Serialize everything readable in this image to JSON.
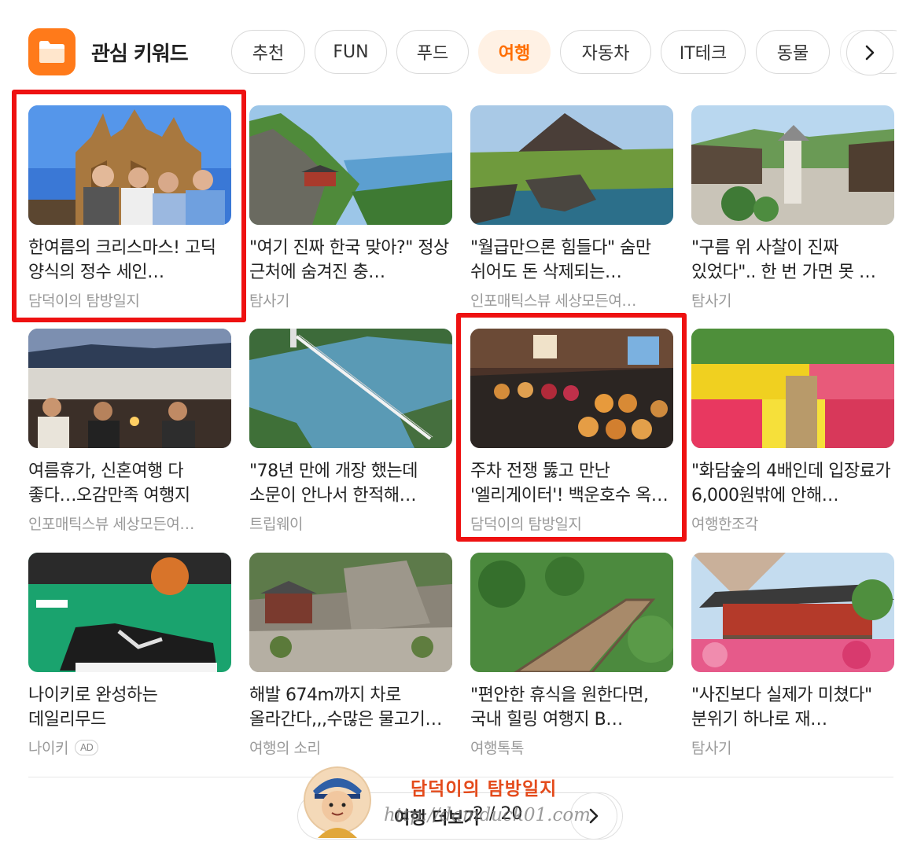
{
  "header": {
    "icon": "folder-icon",
    "title": "관심 키워드",
    "tabs": [
      "추천",
      "FUN",
      "푸드",
      "여행",
      "자동차",
      "IT테크",
      "동물",
      "···"
    ],
    "active_tab": "여행",
    "accent_color": "#ff7a1a"
  },
  "cards": [
    {
      "title": "한여름의 크리스마스! 고딕 양식의 정수 세인…",
      "source": "담덕이의 탐방일지"
    },
    {
      "title": "\"여기 진짜 한국 맞아?\" 정상 근처에 숨겨진 충…",
      "source": "탐사기"
    },
    {
      "title": "\"월급만으론 힘들다\" 숨만 쉬어도 돈 삭제되는…",
      "source": "인포매틱스뷰 세상모든여…"
    },
    {
      "title": "\"구름 위 사찰이 진짜 있었다\".. 한 번 가면 못 …",
      "source": "탐사기"
    },
    {
      "title": "여름휴가, 신혼여행 다 좋다…오감만족 여행지",
      "source": "인포매틱스뷰 세상모든여…"
    },
    {
      "title": "\"78년 만에 개장 했는데 소문이 안나서 한적해…",
      "source": "트립웨이"
    },
    {
      "title": "주차 전쟁 뚫고 만난 '엘리게이터'! 백운호수 옥…",
      "source": "담덕이의 탐방일지"
    },
    {
      "title": "\"화담숲의 4배인데 입장료가 6,000원밖에 안해…",
      "source": "여행한조각"
    },
    {
      "title": "나이키로 완성하는 데일리무드",
      "source": "나이키",
      "badge": "AD"
    },
    {
      "title": "해발 674m까지 차로 올라간다,,,수많은 물고기…",
      "source": "여행의 소리"
    },
    {
      "title": "\"편안한 휴식을 원한다면, 국내 힐링 여행지 B…",
      "source": "여행톡톡"
    },
    {
      "title": "\"사진보다 실제가 미쳤다\" 분위기 하나로 재…",
      "source": "탐사기"
    }
  ],
  "more": {
    "label": "여행 더보기",
    "page": "2 / 20"
  },
  "watermark": {
    "title": "담덕이의 탐방일지",
    "url": "http://damduck01.com"
  },
  "highlight_color": "#ee1111"
}
